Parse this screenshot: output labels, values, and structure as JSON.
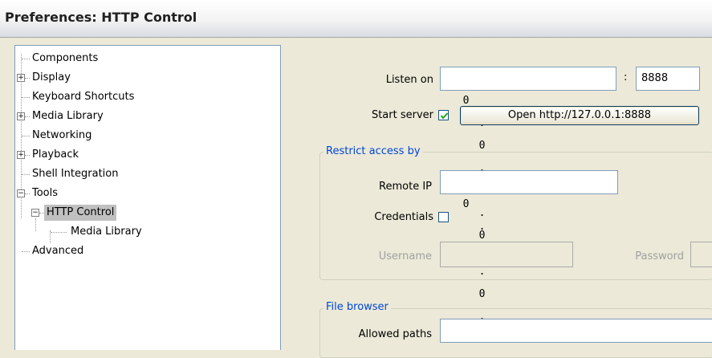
{
  "window": {
    "title": "Preferences: HTTP Control"
  },
  "tree": {
    "components": "Components",
    "display": "Display",
    "keyboard_shortcuts": "Keyboard Shortcuts",
    "media_library": "Media Library",
    "networking": "Networking",
    "playback": "Playback",
    "shell_integration": "Shell Integration",
    "tools": "Tools",
    "http_control": "HTTP Control",
    "http_media_library": "Media Library",
    "advanced": "Advanced",
    "expand_glyph": "+",
    "collapse_glyph": "−"
  },
  "listen": {
    "label": "Listen on",
    "ip": [
      "0",
      "0",
      "0",
      "0"
    ],
    "dot": ".",
    "colon": ":",
    "port": "8888"
  },
  "server": {
    "label": "Start server",
    "checked": true,
    "open_button": "Open http://127.0.0.1:8888"
  },
  "restrict": {
    "title": "Restrict access by",
    "remote_ip_label": "Remote IP",
    "remote_ip": [
      "0",
      "0",
      "0",
      "0"
    ],
    "credentials_label": "Credentials",
    "credentials_checked": false,
    "username_label": "Username",
    "password_label": "Password"
  },
  "file_browser": {
    "title": "File browser",
    "allowed_paths_label": "Allowed paths",
    "allowed_paths_value": ""
  }
}
